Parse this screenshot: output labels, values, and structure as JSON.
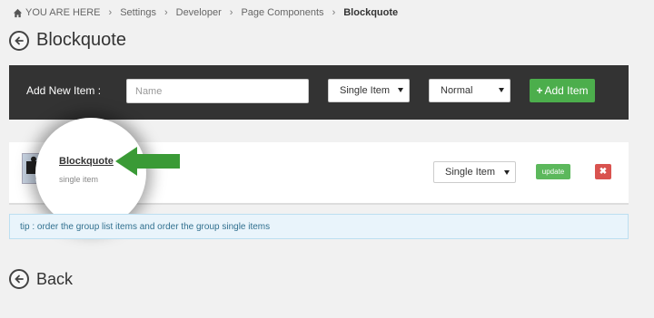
{
  "breadcrumb": {
    "home_label": "YOU ARE HERE",
    "items": [
      "Settings",
      "Developer",
      "Page Components"
    ],
    "current": "Blockquote"
  },
  "page": {
    "title": "Blockquote",
    "back_label": "Back"
  },
  "add_bar": {
    "label": "Add New Item :",
    "name_placeholder": "Name",
    "type_select": "Single Item",
    "style_select": "Normal",
    "add_button": "Add Item"
  },
  "item": {
    "title": "Blockquote",
    "subtitle": "single item",
    "type_select": "Single Item",
    "update_button": "update",
    "delete_symbol": "✖"
  },
  "tip": "tip : order the group list items and order the group single items",
  "colors": {
    "bar": "#333333",
    "add": "#4cae4c",
    "update": "#5cb85c",
    "delete": "#d9534f",
    "arrow": "#3a9a36",
    "tip_bg": "#e9f4fb"
  },
  "icons": [
    "home-icon",
    "back-arrow-icon",
    "puzzle-icon",
    "pointer-arrow-icon",
    "plus-icon",
    "close-icon"
  ]
}
